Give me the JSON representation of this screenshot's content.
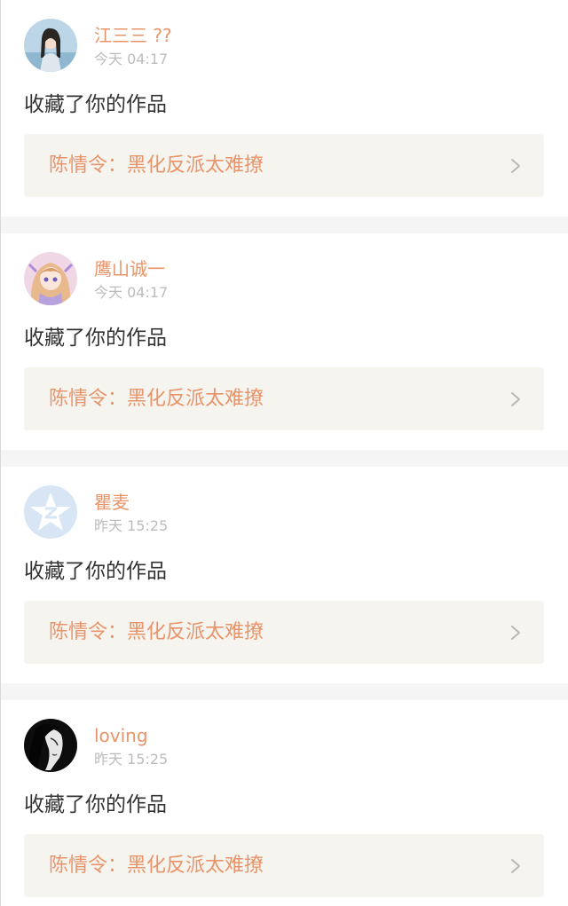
{
  "notifications": [
    {
      "username": "江三三 ??",
      "time": "今天 04:17",
      "action": "收藏了你的作品",
      "work_title": "陈情令：黑化反派太难撩",
      "avatar_icon": "girl-portrait-avatar"
    },
    {
      "username": "鹰山诚一",
      "time": "今天 04:17",
      "action": "收藏了你的作品",
      "work_title": "陈情令：黑化反派太难撩",
      "avatar_icon": "anime-girl-avatar"
    },
    {
      "username": "瞿麦",
      "time": "昨天 15:25",
      "action": "收藏了你的作品",
      "work_title": "陈情令：黑化反派太难撩",
      "avatar_icon": "default-star-avatar"
    },
    {
      "username": "loving",
      "time": "昨天 15:25",
      "action": "收藏了你的作品",
      "work_title": "陈情令：黑化反派太难撩",
      "avatar_icon": "dark-portrait-avatar"
    }
  ],
  "colors": {
    "accent": "#e8946a",
    "timestamp": "#bcbcbc",
    "body_text": "#333333",
    "link_bg": "#f5f4ef",
    "separator": "#f6f5f5",
    "default_avatar": "#d7e5f5"
  }
}
